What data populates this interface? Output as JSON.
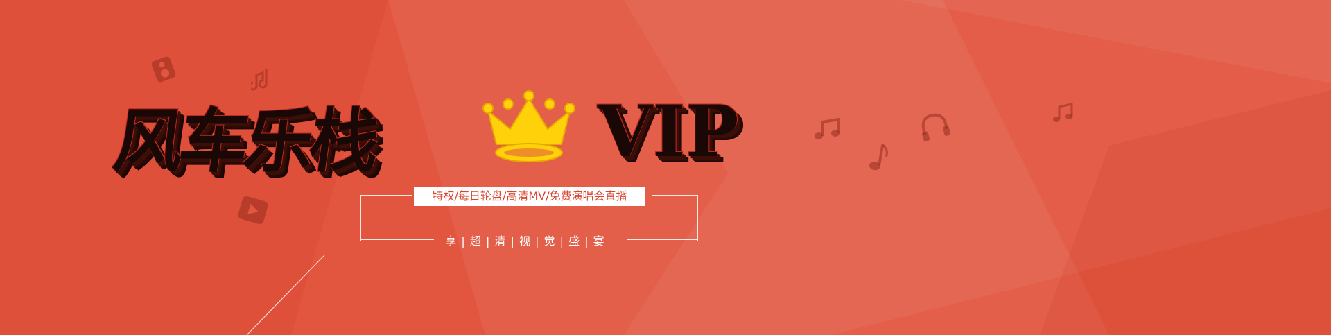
{
  "banner": {
    "brand_name": "风车乐栈",
    "badge": "VIP",
    "features": "特权/每日轮盘/高清MV/免费演唱会直播",
    "slogan": "享 | 超 | 清 | 视 | 觉 | 盛 | 宴",
    "colors": {
      "background": "#e2553f",
      "title": "#1a0806",
      "title_extrude": "#3c0e08",
      "crown_gold": "#ffd10a",
      "accent_white": "#ffffff",
      "icon_tint": "#962d1e"
    },
    "icons": [
      "speaker-icon",
      "music-note-icon",
      "play-icon",
      "crown-icon",
      "headphones-icon"
    ]
  }
}
